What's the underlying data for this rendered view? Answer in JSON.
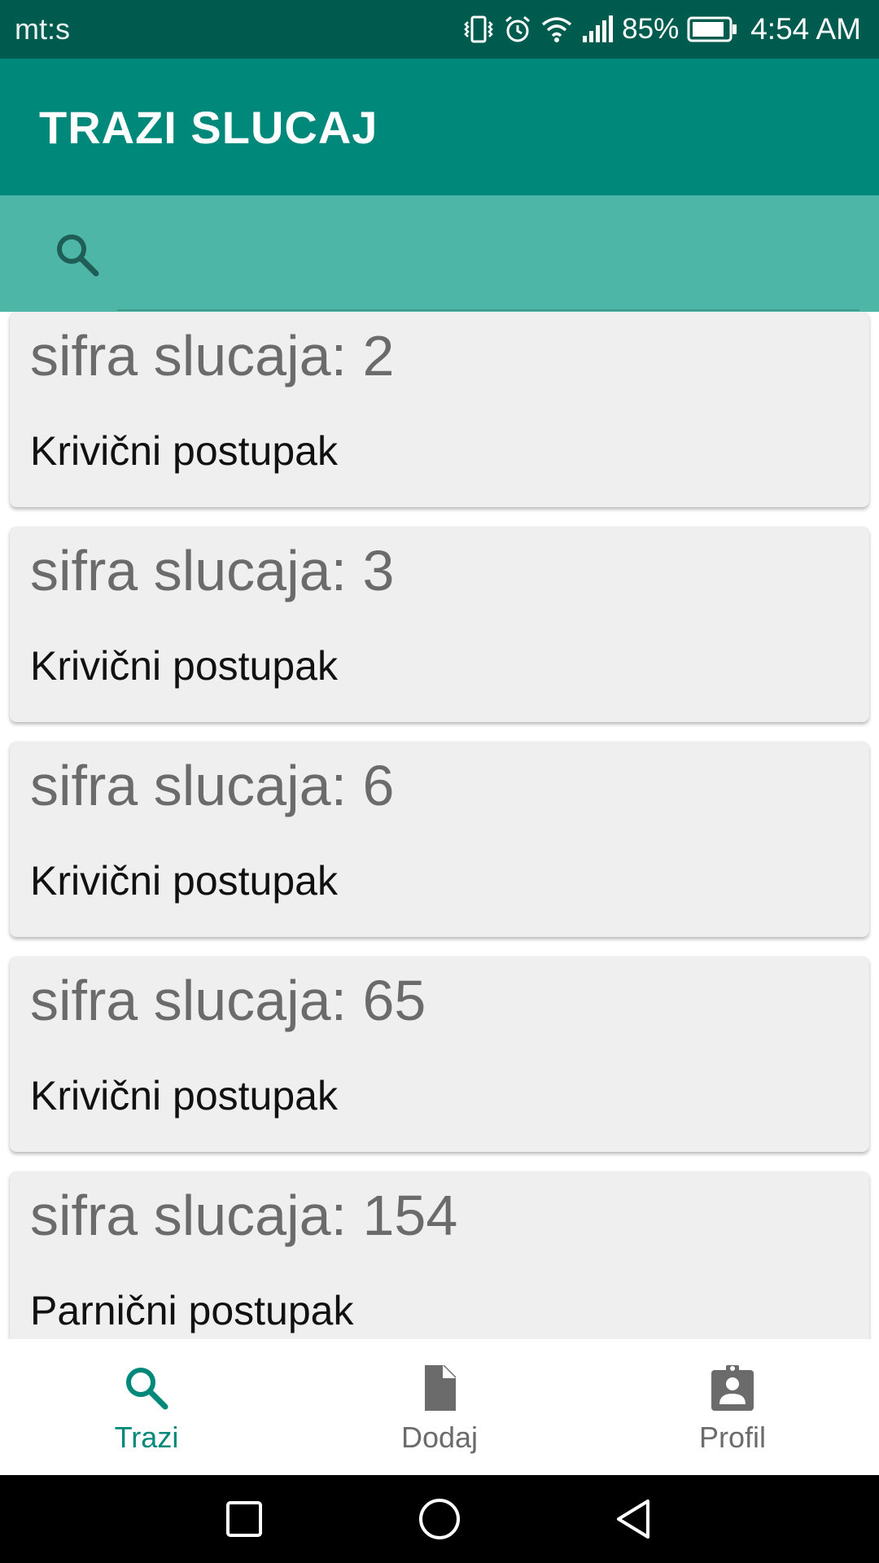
{
  "status_bar": {
    "carrier": "mt:s",
    "battery": "85%",
    "time": "4:54 AM"
  },
  "app_bar": {
    "title": "TRAZI SLUCAJ"
  },
  "search": {
    "value": "",
    "placeholder": ""
  },
  "cases": [
    {
      "code": "sifra slucaja: 2",
      "type": "Krivični postupak"
    },
    {
      "code": "sifra slucaja: 3",
      "type": "Krivični postupak"
    },
    {
      "code": "sifra slucaja: 6",
      "type": "Krivični postupak"
    },
    {
      "code": "sifra slucaja: 65",
      "type": "Krivični postupak"
    },
    {
      "code": "sifra slucaja: 154",
      "type": "Parnični postupak"
    }
  ],
  "bottom_nav": {
    "items": [
      {
        "label": "Trazi",
        "icon": "search-icon",
        "active": true
      },
      {
        "label": "Dodaj",
        "icon": "document-icon",
        "active": false
      },
      {
        "label": "Profil",
        "icon": "profile-badge-icon",
        "active": false
      }
    ]
  },
  "colors": {
    "status_bar": "#005b4f",
    "app_bar": "#00897b",
    "search_bar": "#4db6a6",
    "accent": "#00897b",
    "card": "#efefef"
  }
}
